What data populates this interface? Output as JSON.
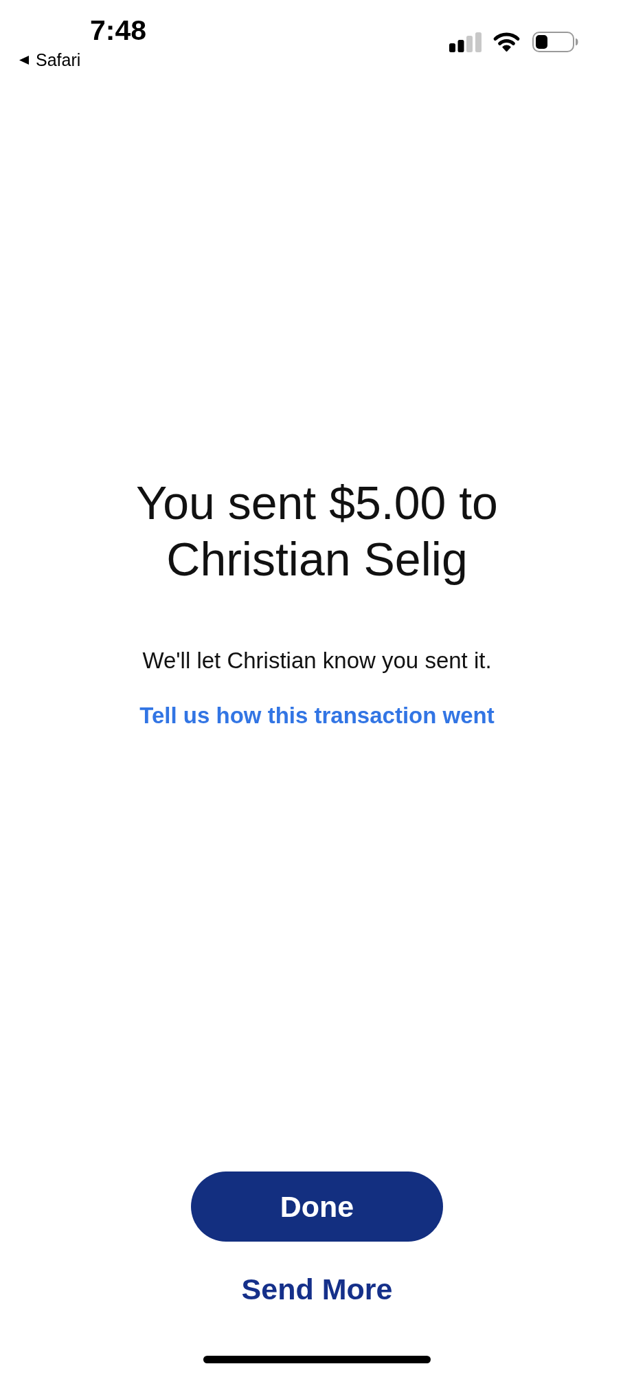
{
  "status_bar": {
    "time": "7:48",
    "back_link": "Safari"
  },
  "confirmation": {
    "title": "You sent $5.00 to Christian Selig",
    "message": "We'll let Christian know you sent it.",
    "feedback_link": "Tell us how this transaction went"
  },
  "actions": [
    {
      "label": "Done",
      "kind": "primary"
    },
    {
      "label": "Send More",
      "kind": "secondary"
    }
  ]
}
